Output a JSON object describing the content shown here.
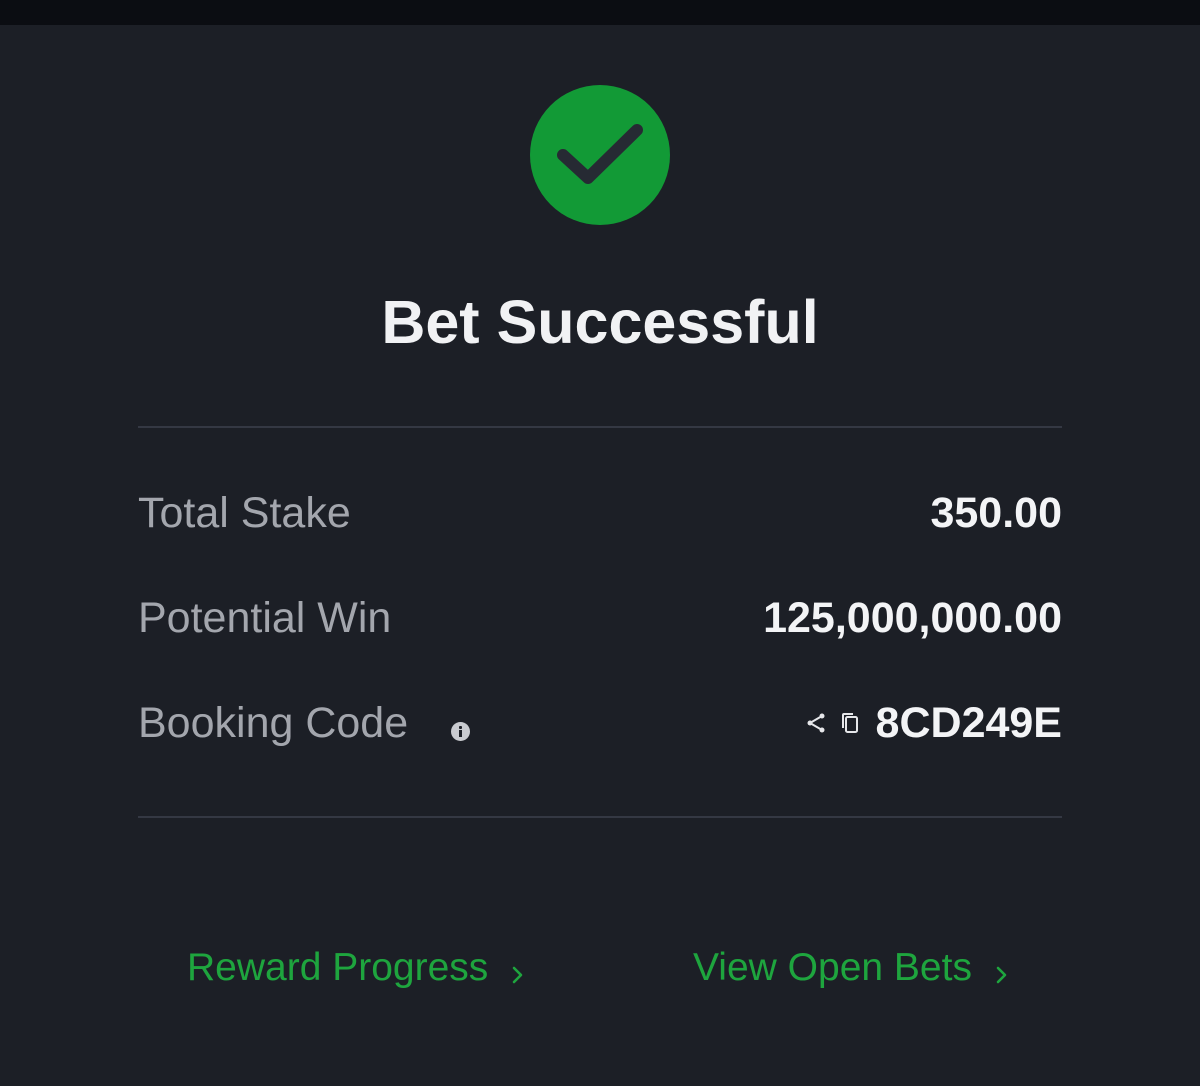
{
  "colors": {
    "background": "#1c1f26",
    "top_bar": "#0b0d12",
    "success_green": "#129a36",
    "link_green": "#1ea53e",
    "label_gray": "#a3a6ad",
    "value_white": "#f3f4f6",
    "divider": "#343843"
  },
  "status": {
    "icon": "checkmark-circle-icon",
    "title": "Bet Successful"
  },
  "details": {
    "total_stake": {
      "label": "Total Stake",
      "value": "350.00"
    },
    "potential_win": {
      "label": "Potential Win",
      "value": "125,000,000.00"
    },
    "booking_code": {
      "label": "Booking Code",
      "info_icon": "info-icon",
      "share_icon": "share-icon",
      "copy_icon": "copy-icon",
      "value": "8CD249E"
    }
  },
  "footer": {
    "reward_progress": {
      "label": "Reward Progress",
      "icon": "chevron-right-icon"
    },
    "view_open_bets": {
      "label": "View Open Bets",
      "icon": "chevron-right-icon"
    }
  }
}
